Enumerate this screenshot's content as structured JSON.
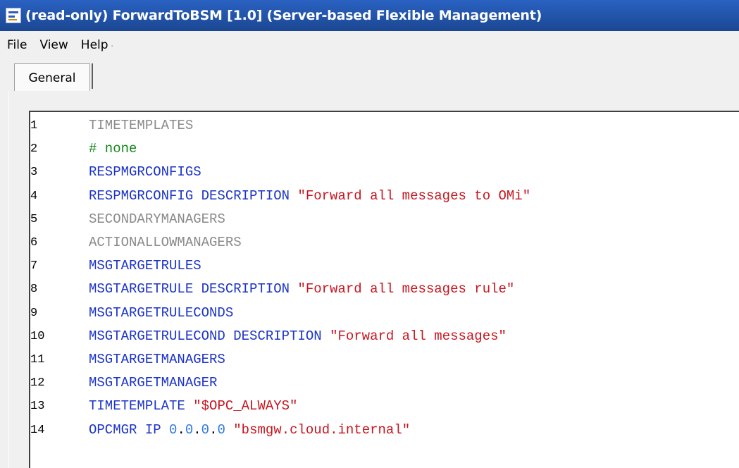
{
  "window": {
    "title": "(read-only) ForwardToBSM [1.0]  (Server-based Flexible Management)",
    "icon": "policy-editor-icon"
  },
  "menu": {
    "file": "File",
    "view": "View",
    "help": "Help",
    "separator": "·"
  },
  "tabs": {
    "general": "General"
  },
  "editor": {
    "colors": {
      "keyword_inactive": "#8a8a8a",
      "keyword": "#1b33c7",
      "string": "#c8141e",
      "comment": "#13871a",
      "number": "#2e77e0"
    },
    "lines": [
      {
        "num": "1",
        "tokens": [
          {
            "t": "TIMETEMPLATES",
            "c": "gray"
          }
        ]
      },
      {
        "num": "2",
        "tokens": [
          {
            "t": "# none",
            "c": "green"
          }
        ]
      },
      {
        "num": "3",
        "tokens": [
          {
            "t": "RESPMGRCONFIGS",
            "c": "blue"
          }
        ]
      },
      {
        "num": "4",
        "tokens": [
          {
            "t": "RESPMGRCONFIG DESCRIPTION ",
            "c": "blue"
          },
          {
            "t": "\"Forward all messages to OMi\"",
            "c": "red"
          }
        ]
      },
      {
        "num": "5",
        "tokens": [
          {
            "t": "SECONDARYMANAGERS",
            "c": "gray"
          }
        ]
      },
      {
        "num": "6",
        "tokens": [
          {
            "t": "ACTIONALLOWMANAGERS",
            "c": "gray"
          }
        ]
      },
      {
        "num": "7",
        "tokens": [
          {
            "t": "MSGTARGETRULES",
            "c": "blue"
          }
        ]
      },
      {
        "num": "8",
        "tokens": [
          {
            "t": "MSGTARGETRULE DESCRIPTION ",
            "c": "blue"
          },
          {
            "t": "\"Forward all messages rule\"",
            "c": "red"
          }
        ]
      },
      {
        "num": "9",
        "tokens": [
          {
            "t": "MSGTARGETRULECONDS",
            "c": "blue"
          }
        ]
      },
      {
        "num": "10",
        "tokens": [
          {
            "t": "MSGTARGETRULECOND DESCRIPTION ",
            "c": "blue"
          },
          {
            "t": "\"Forward all messages\"",
            "c": "red"
          }
        ]
      },
      {
        "num": "11",
        "tokens": [
          {
            "t": "MSGTARGETMANAGERS",
            "c": "blue"
          }
        ]
      },
      {
        "num": "12",
        "tokens": [
          {
            "t": "MSGTARGETMANAGER",
            "c": "blue"
          }
        ]
      },
      {
        "num": "13",
        "tokens": [
          {
            "t": "TIMETEMPLATE ",
            "c": "blue"
          },
          {
            "t": "\"$OPC_ALWAYS\"",
            "c": "red"
          }
        ]
      },
      {
        "num": "14",
        "tokens": [
          {
            "t": "OPCMGR IP ",
            "c": "blue"
          },
          {
            "t": "0",
            "c": "num"
          },
          {
            "t": ".",
            "c": "plain"
          },
          {
            "t": "0",
            "c": "num"
          },
          {
            "t": ".",
            "c": "plain"
          },
          {
            "t": "0",
            "c": "num"
          },
          {
            "t": ".",
            "c": "plain"
          },
          {
            "t": "0",
            "c": "num"
          },
          {
            "t": " ",
            "c": "plain"
          },
          {
            "t": "\"bsmgw.cloud.internal\"",
            "c": "red"
          }
        ]
      }
    ]
  }
}
